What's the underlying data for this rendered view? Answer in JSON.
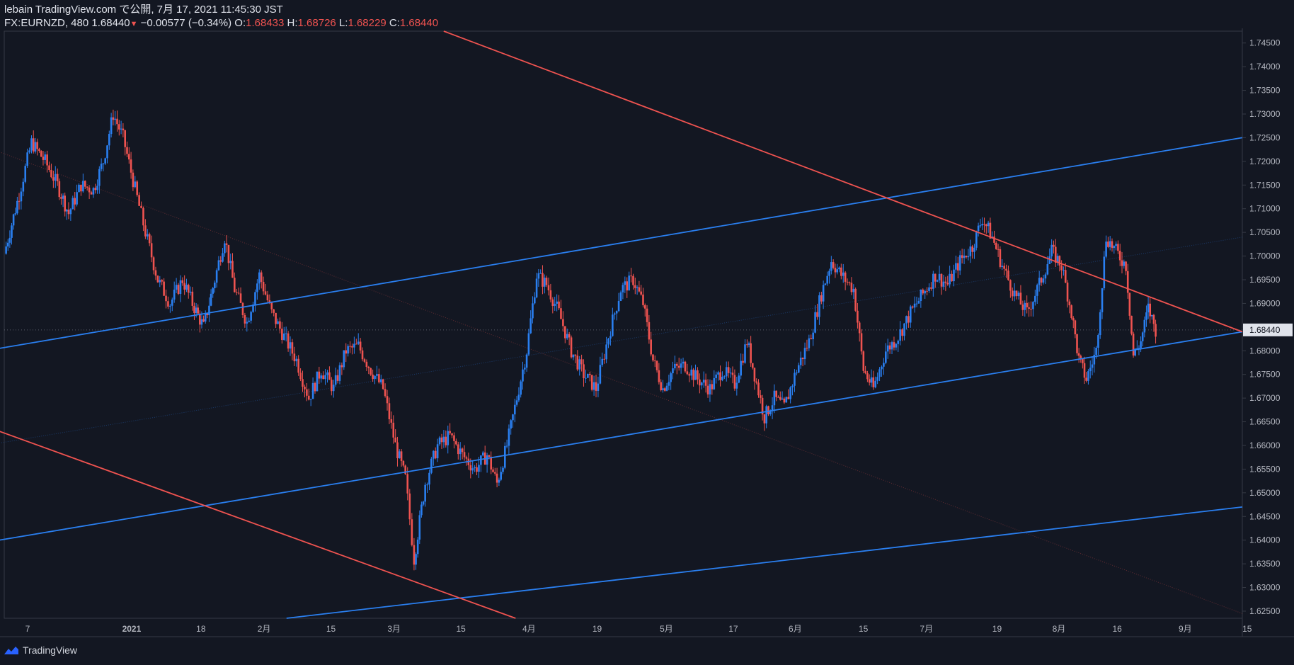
{
  "header": {
    "line1": "lebain TradingView.com で公開, 7月 17, 2021 11:45:30 JST",
    "symbol": "FX:EURNZD, 480",
    "last": "1.68440",
    "change": "−0.00577 (−0.34%)",
    "o_label": "O:",
    "o": "1.68433",
    "h_label": "H:",
    "h": "1.68726",
    "l_label": "L:",
    "l": "1.68229",
    "c_label": "C:",
    "c": "1.68440"
  },
  "footer": {
    "brand": "TradingView",
    "logo_icon": "tradingview-logo-icon"
  },
  "colors": {
    "bg": "#131722",
    "up": "#2a7ff0",
    "down": "#ef5350",
    "grid": "#2a2e39",
    "text": "#b2b5be"
  },
  "chart_data": {
    "type": "candlestick",
    "symbol": "FX:EURNZD",
    "interval": "480",
    "last_price": 1.6844,
    "y_ticks": [
      "1.74500",
      "1.74000",
      "1.73500",
      "1.73000",
      "1.72500",
      "1.72000",
      "1.71500",
      "1.71000",
      "1.70500",
      "1.70000",
      "1.69500",
      "1.69000",
      "1.68500",
      "1.68000",
      "1.67500",
      "1.67000",
      "1.66500",
      "1.66000",
      "1.65500",
      "1.65000",
      "1.64500",
      "1.64000",
      "1.63500",
      "1.63000",
      "1.62500"
    ],
    "ylim": [
      1.6235,
      1.7475
    ],
    "x_ticks": [
      "7",
      "2021",
      "18",
      "2月",
      "15",
      "3月",
      "15",
      "4月",
      "19",
      "5月",
      "17",
      "6月",
      "15",
      "7月",
      "19",
      "8月",
      "16",
      "9月",
      "15"
    ],
    "x_tick_pos": [
      0.0,
      0.084,
      0.14,
      0.191,
      0.245,
      0.296,
      0.35,
      0.405,
      0.46,
      0.516,
      0.57,
      0.62,
      0.675,
      0.726,
      0.783,
      0.833,
      0.88,
      0.935,
      0.985
    ],
    "price_path": [
      [
        0.0,
        1.7005
      ],
      [
        0.012,
        1.713
      ],
      [
        0.022,
        1.724
      ],
      [
        0.033,
        1.72
      ],
      [
        0.043,
        1.715
      ],
      [
        0.052,
        1.709
      ],
      [
        0.062,
        1.715
      ],
      [
        0.072,
        1.714
      ],
      [
        0.08,
        1.72
      ],
      [
        0.088,
        1.73
      ],
      [
        0.096,
        1.725
      ],
      [
        0.104,
        1.716
      ],
      [
        0.114,
        1.705
      ],
      [
        0.124,
        1.695
      ],
      [
        0.134,
        1.69
      ],
      [
        0.144,
        1.695
      ],
      [
        0.152,
        1.69
      ],
      [
        0.161,
        1.685
      ],
      [
        0.17,
        1.695
      ],
      [
        0.178,
        1.704
      ],
      [
        0.186,
        1.693
      ],
      [
        0.196,
        1.686
      ],
      [
        0.206,
        1.696
      ],
      [
        0.216,
        1.688
      ],
      [
        0.226,
        1.683
      ],
      [
        0.236,
        1.678
      ],
      [
        0.246,
        1.67
      ],
      [
        0.256,
        1.676
      ],
      [
        0.266,
        1.672
      ],
      [
        0.276,
        1.68
      ],
      [
        0.286,
        1.681
      ],
      [
        0.296,
        1.676
      ],
      [
        0.306,
        1.672
      ],
      [
        0.316,
        1.66
      ],
      [
        0.324,
        1.653
      ],
      [
        0.331,
        1.636
      ],
      [
        0.34,
        1.652
      ],
      [
        0.35,
        1.66
      ],
      [
        0.36,
        1.662
      ],
      [
        0.37,
        1.658
      ],
      [
        0.38,
        1.655
      ],
      [
        0.39,
        1.658
      ],
      [
        0.398,
        1.652
      ],
      [
        0.406,
        1.66
      ],
      [
        0.414,
        1.67
      ],
      [
        0.422,
        1.68
      ],
      [
        0.43,
        1.696
      ],
      [
        0.438,
        1.694
      ],
      [
        0.448,
        1.688
      ],
      [
        0.458,
        1.68
      ],
      [
        0.468,
        1.675
      ],
      [
        0.478,
        1.672
      ],
      [
        0.488,
        1.683
      ],
      [
        0.498,
        1.693
      ],
      [
        0.508,
        1.695
      ],
      [
        0.516,
        1.69
      ],
      [
        0.524,
        1.678
      ],
      [
        0.532,
        1.672
      ],
      [
        0.54,
        1.676
      ],
      [
        0.55,
        1.677
      ],
      [
        0.56,
        1.674
      ],
      [
        0.57,
        1.672
      ],
      [
        0.58,
        1.676
      ],
      [
        0.59,
        1.673
      ],
      [
        0.6,
        1.682
      ],
      [
        0.606,
        1.675
      ],
      [
        0.614,
        1.666
      ],
      [
        0.622,
        1.67
      ],
      [
        0.63,
        1.668
      ],
      [
        0.64,
        1.676
      ],
      [
        0.65,
        1.682
      ],
      [
        0.66,
        1.692
      ],
      [
        0.668,
        1.699
      ],
      [
        0.676,
        1.696
      ],
      [
        0.686,
        1.693
      ],
      [
        0.694,
        1.676
      ],
      [
        0.702,
        1.672
      ],
      [
        0.712,
        1.68
      ],
      [
        0.722,
        1.683
      ],
      [
        0.732,
        1.688
      ],
      [
        0.742,
        1.692
      ],
      [
        0.752,
        1.696
      ],
      [
        0.762,
        1.694
      ],
      [
        0.772,
        1.699
      ],
      [
        0.782,
        1.702
      ],
      [
        0.79,
        1.708
      ],
      [
        0.798,
        1.704
      ],
      [
        0.806,
        1.698
      ],
      [
        0.816,
        1.692
      ],
      [
        0.826,
        1.688
      ],
      [
        0.836,
        1.694
      ],
      [
        0.846,
        1.701
      ],
      [
        0.854,
        1.698
      ],
      [
        0.862,
        1.688
      ],
      [
        0.868,
        1.678
      ],
      [
        0.874,
        1.674
      ],
      [
        0.882,
        1.68
      ],
      [
        0.89,
        1.704
      ],
      [
        0.898,
        1.701
      ],
      [
        0.906,
        1.698
      ],
      [
        0.912,
        1.679
      ],
      [
        0.918,
        1.682
      ],
      [
        0.924,
        1.689
      ],
      [
        0.93,
        1.6844
      ]
    ],
    "trendlines": [
      {
        "name": "upper-channel-line",
        "color": "#2a7ff0",
        "points": [
          [
            -0.004,
            1.6805
          ],
          [
            1.0,
            1.725
          ]
        ]
      },
      {
        "name": "middle-channel-line",
        "color": "#2a7ff0",
        "points": [
          [
            -0.004,
            1.64
          ],
          [
            1.0,
            1.684
          ]
        ]
      },
      {
        "name": "lower-channel-line",
        "color": "#2a7ff0",
        "points": [
          [
            0.228,
            1.6235
          ],
          [
            1.0,
            1.647
          ]
        ]
      },
      {
        "name": "upper-descending-line",
        "color": "#ef5350",
        "points": [
          [
            0.355,
            1.7475
          ],
          [
            1.0,
            1.684
          ]
        ]
      },
      {
        "name": "lower-descending-line",
        "color": "#ef5350",
        "points": [
          [
            -0.004,
            1.663
          ],
          [
            0.413,
            1.6235
          ]
        ]
      }
    ],
    "faint_lines": [
      {
        "name": "faint-red-diagonal",
        "color": "#ef5350",
        "points": [
          [
            -0.004,
            1.722
          ],
          [
            1.0,
            1.6245
          ]
        ]
      },
      {
        "name": "faint-blue-diagonal",
        "color": "#2a7ff0",
        "points": [
          [
            -0.004,
            1.6605
          ],
          [
            1.0,
            1.704
          ]
        ]
      }
    ]
  }
}
